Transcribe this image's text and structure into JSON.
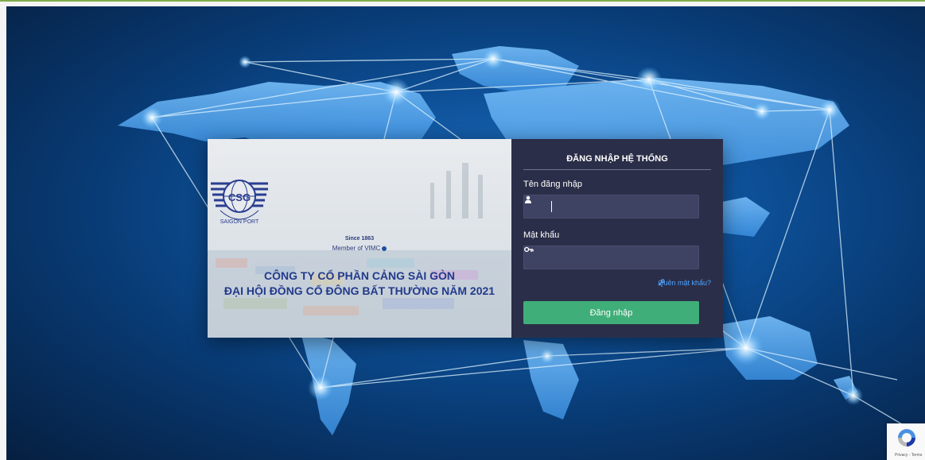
{
  "login": {
    "title": "ĐĂNG NHẬP HỆ THỐNG",
    "username_label": "Tên đăng nhập",
    "username_value": "",
    "password_label": "Mật khẩu",
    "password_value": "",
    "forgot_label": "Quên mật khẩu?",
    "submit_label": "Đăng nhập"
  },
  "company": {
    "logo_text": "CSG",
    "logo_ring_text": "SAIGON PORT",
    "since": "Since 1863",
    "member": "Member of VIMC",
    "name_line1": "CÔNG TY CỔ PHẦN CẢNG SÀI GÒN",
    "name_line2": "ĐẠI HỘI ĐỒNG CỔ ĐÔNG BẤT THƯỜNG NĂM 2021"
  },
  "recaptcha": {
    "label": "Privacy - Terms"
  },
  "icons": {
    "username": "user-icon",
    "password": "key-icon",
    "forgot": "wrench-icon",
    "recaptcha": "recaptcha-logo-icon"
  },
  "colors": {
    "panel_dark": "#2b2e48",
    "button_green": "#3fae78",
    "link_blue": "#4da3ff",
    "company_blue": "#233a8c"
  }
}
